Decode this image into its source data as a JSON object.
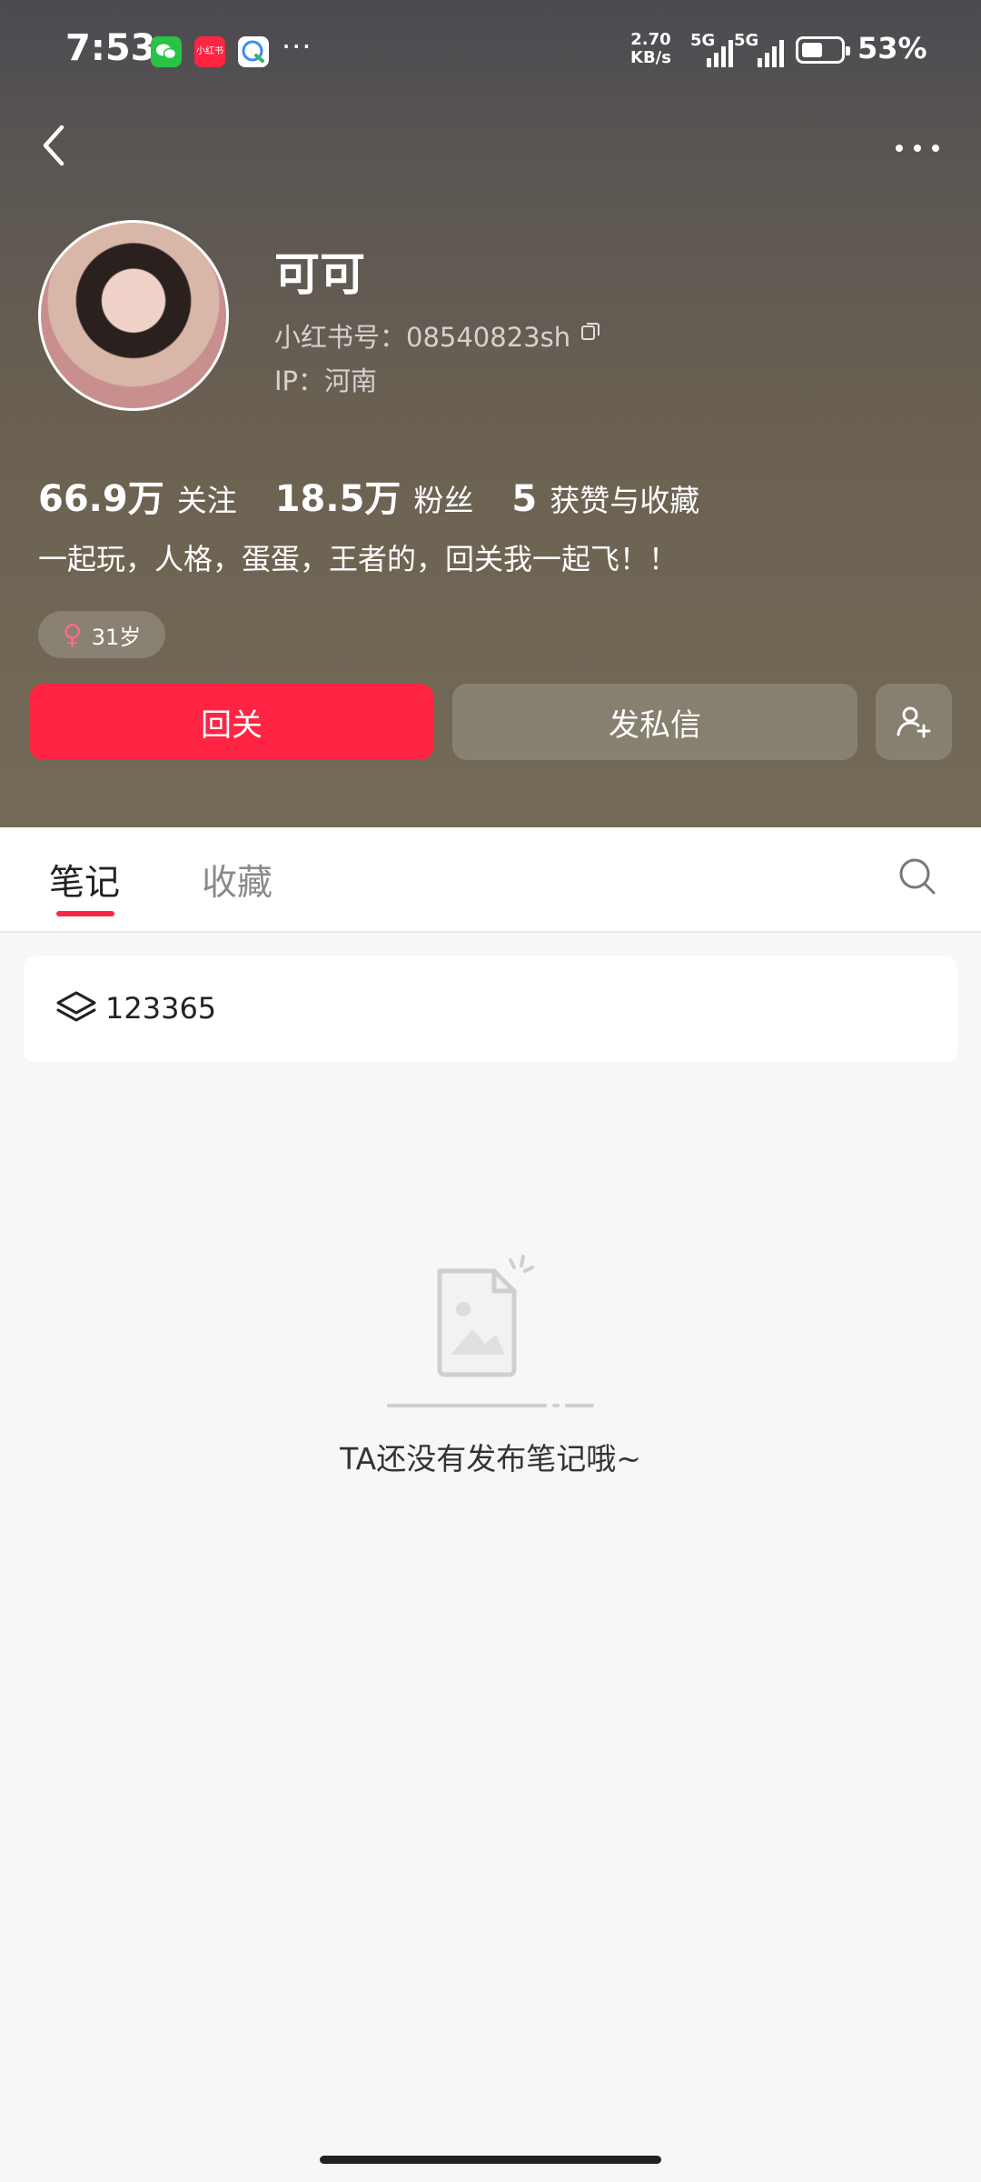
{
  "status_bar": {
    "time": "7:53",
    "app_icons": [
      "wechat-icon",
      "xiaohongshu-icon",
      "qq-browser-icon"
    ],
    "app_label": "小红书",
    "more": "···",
    "net_speed_value": "2.70",
    "net_speed_unit": "KB/s",
    "signal_1": "5G",
    "signal_2": "5G",
    "battery_level": 0.53,
    "battery": "53%"
  },
  "profile": {
    "nickname": "可可",
    "red_id": "小红书号：08540823sh",
    "ip": "IP：河南",
    "stats": [
      {
        "value": "66.9万",
        "label": "关注"
      },
      {
        "value": "18.5万",
        "label": "粉丝"
      },
      {
        "value": "5",
        "label": "获赞与收藏"
      }
    ],
    "bio": "一起玩，人格，蛋蛋，王者的，回关我一起飞！！",
    "age_tag": "31岁",
    "gender_symbol": "♀"
  },
  "actions": {
    "follow_back": "回关",
    "message": "发私信"
  },
  "tabs": [
    {
      "label": "笔记",
      "active": true
    },
    {
      "label": "收藏",
      "active": false
    }
  ],
  "collection": {
    "name": "123365"
  },
  "empty_state": {
    "text": "TA还没有发布笔记哦~"
  },
  "colors": {
    "accent": "#ff2442",
    "header_bg": "#6c6252",
    "page_bg": "#f7f7f7"
  }
}
